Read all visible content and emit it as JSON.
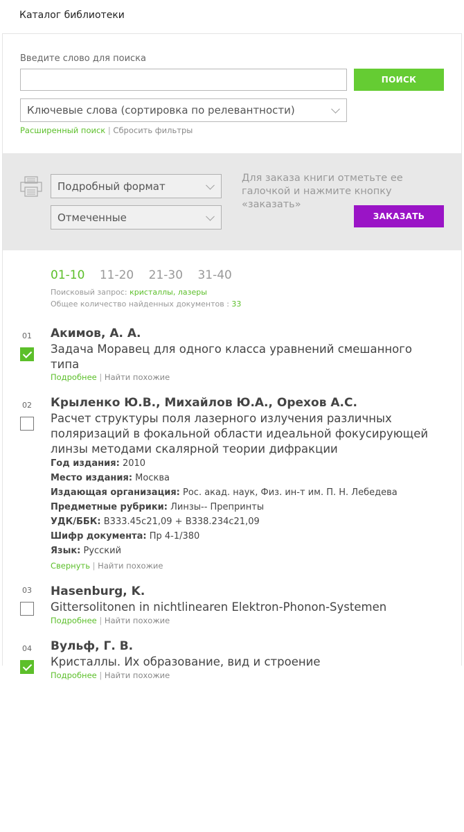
{
  "page_title": "Каталог библиотеки",
  "search": {
    "label": "Введите слово для поиска",
    "value": "",
    "button": "ПОИСК",
    "sort_option": "Ключевые слова (сортировка по релевантности)",
    "advanced_link": "Расширенный поиск",
    "separator": "|",
    "reset_link": "Сбросить фильтры"
  },
  "order_panel": {
    "format_option": "Подробный формат",
    "selection_option": "Отмеченные",
    "hint": "Для заказа книги отметьте ее галочкой и нажмите кнопку «заказать»",
    "order_button": "ЗАКАЗАТЬ",
    "print_icon": "printer-icon"
  },
  "pagination": [
    "01-10",
    "11-20",
    "21-30",
    "31-40"
  ],
  "pagination_active": "01-10",
  "query": {
    "label": "Поисковый запрос:",
    "value": "кристаллы, лазеры",
    "total_label": "Общее количество найденных документов :",
    "total_value": "33"
  },
  "colors": {
    "accent_green": "#65cc33",
    "accent_purple": "#9a14c6",
    "panel_grey": "#e8e8e8"
  },
  "records": [
    {
      "num": "01",
      "checked": true,
      "author": "Акимов, А. А.",
      "title": "Задача Моравец для одного класса уравнений смешанного типа",
      "link_more": "Подробнее",
      "sep": "|",
      "link_similar": "Найти похожие"
    },
    {
      "num": "02",
      "checked": false,
      "author": "Крыленко Ю.В., Михайлов Ю.А., Орехов А.С.",
      "title": "Расчет структуры поля лазерного излучения различных поляризаций в фокальной области идеальной фокусирующей линзы методами скалярной теории дифракции",
      "fields": [
        {
          "label": "Год издания:",
          "value": "2010"
        },
        {
          "label": "Место издания:",
          "value": "Москва"
        },
        {
          "label": "Издающая организация:",
          "value": "Рос. акад. наук, Физ. ин-т им. П. Н. Лебедева"
        },
        {
          "label": "Предметные рубрики:",
          "value": "Линзы-- Препринты"
        },
        {
          "label": "УДК/ББК:",
          "value": "В333.45с21,09 + В338.234с21,09"
        },
        {
          "label": "Шифр документа:",
          "value": "Пр 4-1/380"
        },
        {
          "label": "Язык:",
          "value": "Русский"
        }
      ],
      "link_more": "Свернуть",
      "sep": "|",
      "link_similar": "Найти похожие"
    },
    {
      "num": "03",
      "checked": false,
      "author": "Hasenburg, K.",
      "title": "Gittersolitonen in nichtlinearen Elektron-Phonon-Systemen",
      "link_more": "Подробнее",
      "sep": "|",
      "link_similar": "Найти похожие"
    },
    {
      "num": "04",
      "checked": true,
      "author": "Вульф, Г. В.",
      "title": "Кристаллы. Их образование, вид и строение",
      "link_more": "Подробнее",
      "sep": "|",
      "link_similar": "Найти похожие"
    }
  ]
}
